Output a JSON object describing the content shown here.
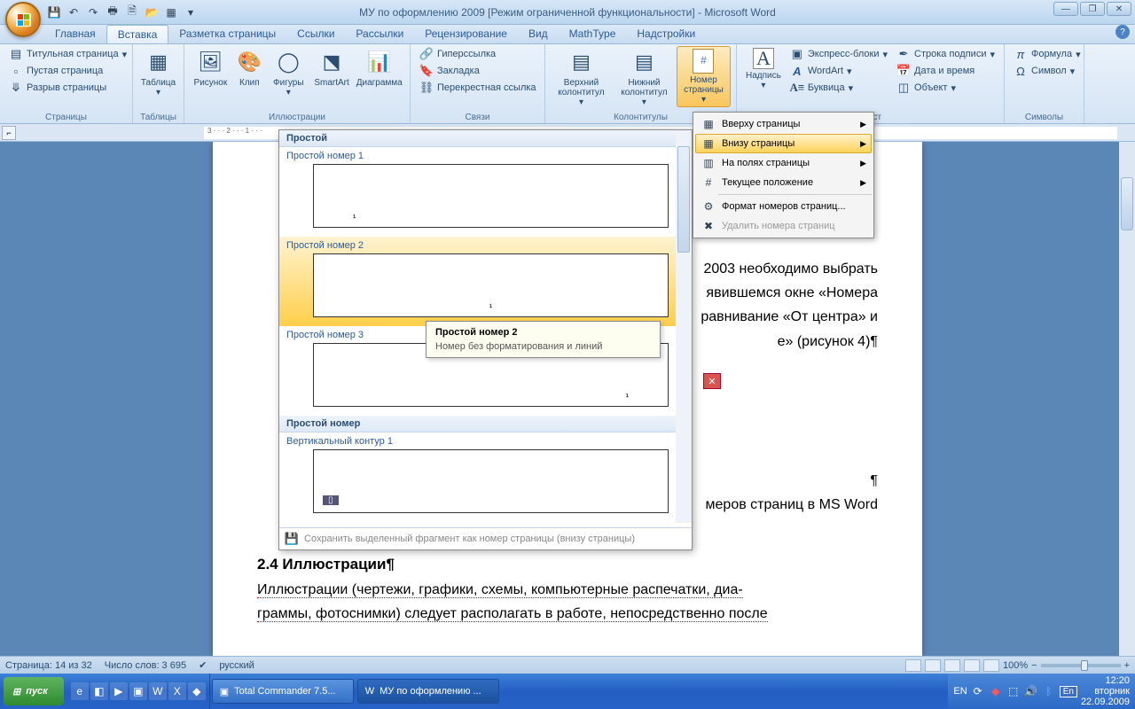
{
  "title": "МУ по оформлению 2009 [Режим ограниченной функциональности] - Microsoft Word",
  "tabs": [
    "Главная",
    "Вставка",
    "Разметка страницы",
    "Ссылки",
    "Рассылки",
    "Рецензирование",
    "Вид",
    "MathType",
    "Надстройки"
  ],
  "active_tab": 1,
  "ribbon": {
    "pages": {
      "title_page": "Титульная страница",
      "blank": "Пустая страница",
      "break": "Разрыв страницы",
      "label": "Страницы"
    },
    "tables": {
      "table": "Таблица",
      "label": "Таблицы"
    },
    "illus": {
      "pic": "Рисунок",
      "clip": "Клип",
      "shapes": "Фигуры",
      "smart": "SmartArt",
      "chart": "Диаграмма",
      "label": "Иллюстрации"
    },
    "links": {
      "hyper": "Гиперссылка",
      "bookmark": "Закладка",
      "cross": "Перекрестная ссылка",
      "label": "Связи"
    },
    "hf": {
      "header": "Верхний колонтитул",
      "footer": "Нижний колонтитул",
      "pagenum": "Номер страницы",
      "label": "Колонтитулы"
    },
    "text": {
      "textbox": "Надпись",
      "quick": "Экспресс-блоки",
      "wordart": "WordArt",
      "dropcap": "Буквица",
      "sig": "Строка подписи",
      "dt": "Дата и время",
      "obj": "Объект",
      "label": "Текст"
    },
    "sym": {
      "eq": "Формула",
      "sym": "Символ",
      "label": "Символы"
    }
  },
  "pn_menu": {
    "top": "Вверху страницы",
    "bottom": "Внизу страницы",
    "margins": "На полях страницы",
    "current": "Текущее положение",
    "format": "Формат номеров страниц...",
    "delete": "Удалить номера страниц"
  },
  "gallery": {
    "h1": "Простой",
    "i1": "Простой номер 1",
    "i2": "Простой номер 2",
    "i3": "Простой номер 3",
    "h2": "Простой номер",
    "i4": "Вертикальный контур 1",
    "save": "Сохранить выделенный фрагмент как номер страницы (внизу страницы)"
  },
  "tooltip": {
    "title": "Простой номер 2",
    "desc": "Номер без форматирования и линий"
  },
  "doc": {
    "l1": "2003 необходимо выбрать",
    "l2": "явившемся окне «Номера",
    "l3": "равнивание «От центра» и",
    "l4": "е» (рисунок 4)¶",
    "l5": "¶",
    "l6": "меров страниц в MS Word",
    "h": "2.4 Иллюстрации¶",
    "p": "Иллюстрации (чертежи, графики, схемы, компьютерные распечатки, диа-",
    "p2": "граммы, фотоснимки) следует располагать в работе, непосредственно после"
  },
  "status": {
    "page": "Страница: 14 из 32",
    "words": "Число слов: 3 695",
    "lang": "русский",
    "zoom": "100%"
  },
  "taskbar": {
    "start": "пуск",
    "t1": "Total Commander 7.5...",
    "t2": "МУ по оформлению ...",
    "lang": "En",
    "time": "12:20",
    "date": "22.09.2009",
    "day": "вторник",
    "en": "EN"
  }
}
